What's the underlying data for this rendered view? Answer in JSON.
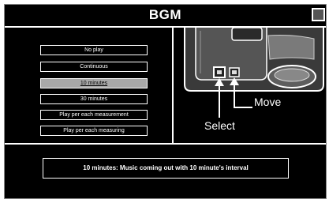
{
  "window": {
    "title": "BGM"
  },
  "menu": {
    "items": [
      {
        "label": "No play",
        "selected": false
      },
      {
        "label": "Continuous",
        "selected": false
      },
      {
        "label": "10 minutes",
        "selected": true
      },
      {
        "label": "30 minutes",
        "selected": false
      },
      {
        "label": "Play per each measurement",
        "selected": false
      },
      {
        "label": "Play per each measuring",
        "selected": false
      }
    ]
  },
  "diagram": {
    "move_label": "Move",
    "select_label": "Select"
  },
  "info": {
    "text": "10 minutes: Music coming out with 10 minute's interval"
  },
  "colors": {
    "background": "#000000",
    "foreground": "#ffffff",
    "selected_item": "#a8a8a8"
  }
}
